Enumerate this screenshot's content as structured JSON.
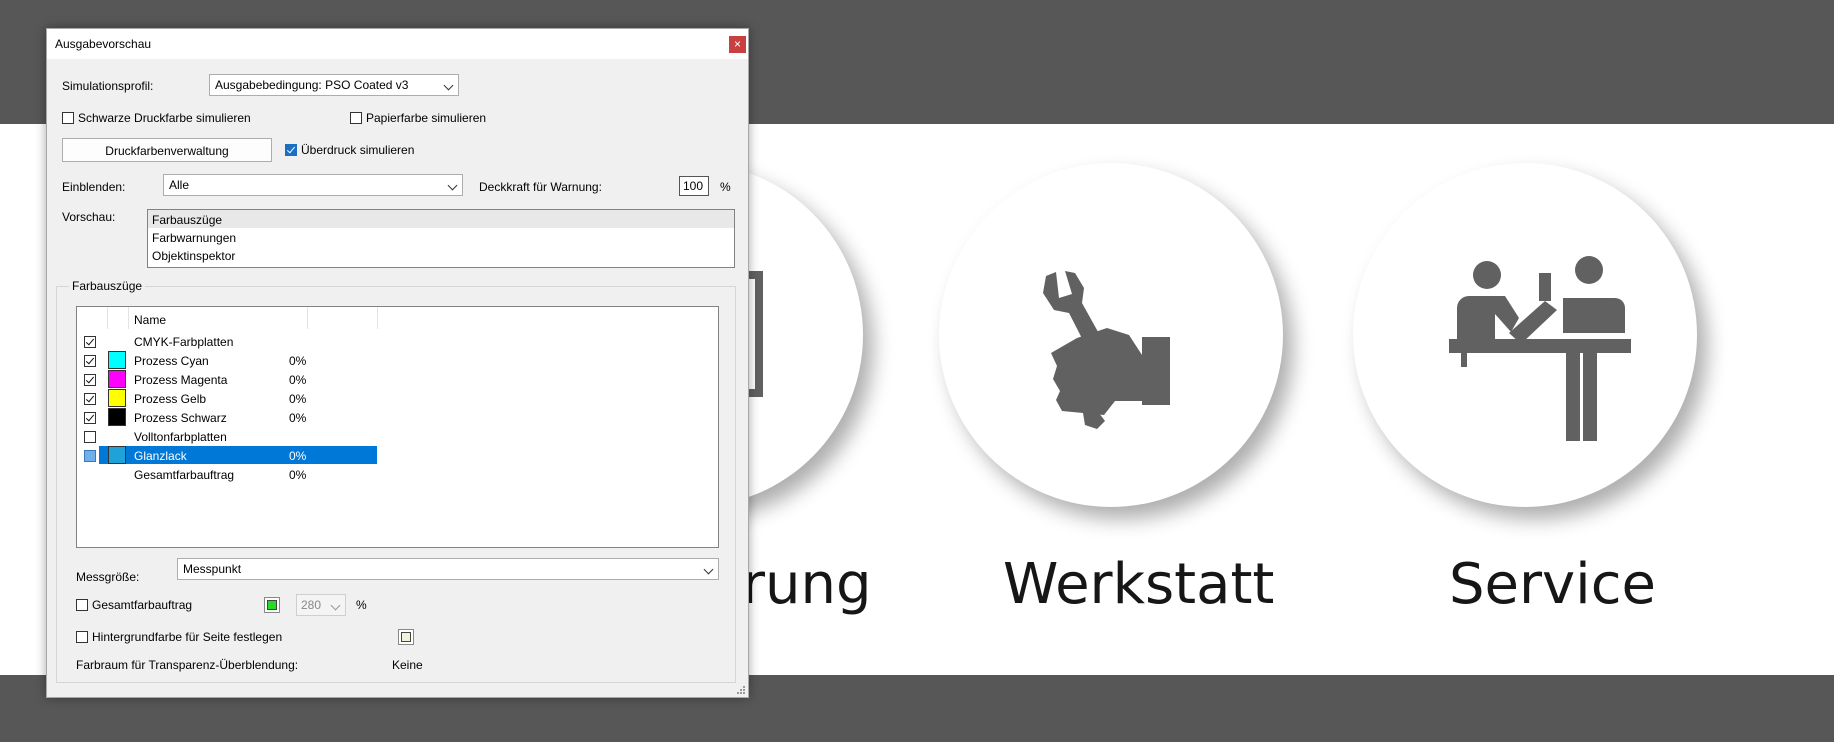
{
  "background": {
    "items": [
      {
        "label": "rung",
        "icon": "clipboard-icon"
      },
      {
        "label": "Werkstatt",
        "icon": "wrench-hand-icon"
      },
      {
        "label": "Service",
        "icon": "service-counter-icon"
      }
    ]
  },
  "dialog": {
    "title": "Ausgabevorschau",
    "close_glyph": "×",
    "simulation_profile_label": "Simulationsprofil:",
    "simulation_profile_value": "Ausgabebedingung: PSO Coated v3",
    "simulate_black_ink": {
      "label": "Schwarze Druckfarbe simulieren",
      "checked": false
    },
    "simulate_paper_color": {
      "label": "Papierfarbe simulieren",
      "checked": false
    },
    "ink_manager_button": "Druckfarbenverwaltung",
    "simulate_overprint": {
      "label": "Überdruck simulieren",
      "checked": true
    },
    "show_label": "Einblenden:",
    "show_value": "Alle",
    "warning_opacity_label": "Deckkraft für Warnung:",
    "warning_opacity_value": "100",
    "warning_opacity_unit": "%",
    "preview_label": "Vorschau:",
    "preview_options": [
      "Farbauszüge",
      "Farbwarnungen",
      "Objektinspektor"
    ],
    "preview_selected": "Farbauszüge",
    "separations_group_title": "Farbauszüge",
    "separations_column_name": "Name",
    "separations": [
      {
        "name": "CMYK-Farbplatten",
        "checked": true,
        "color": null,
        "percent": ""
      },
      {
        "name": "Prozess Cyan",
        "checked": true,
        "color": "#00ffff",
        "percent": "0%"
      },
      {
        "name": "Prozess Magenta",
        "checked": true,
        "color": "#ff00ff",
        "percent": "0%"
      },
      {
        "name": "Prozess Gelb",
        "checked": true,
        "color": "#ffff00",
        "percent": "0%"
      },
      {
        "name": "Prozess Schwarz",
        "checked": true,
        "color": "#000000",
        "percent": "0%"
      },
      {
        "name": "Volltonfarbplatten",
        "checked": false,
        "color": null,
        "percent": ""
      },
      {
        "name": "Glanzlack",
        "checked": false,
        "color": "#1ea2d8",
        "percent": "0%",
        "selected": true
      },
      {
        "name": "Gesamtfarbauftrag",
        "checked": null,
        "color": null,
        "percent": "0%"
      }
    ],
    "sample_size_label": "Messgröße:",
    "sample_size_value": "Messpunkt",
    "total_area_coverage": {
      "label": "Gesamtfarbauftrag",
      "checked": false,
      "swatch_color": "#22dd22",
      "value": "280",
      "unit": "%"
    },
    "page_background": {
      "label": "Hintergrundfarbe für Seite festlegen",
      "checked": false,
      "swatch_color": "#f2f2d8"
    },
    "blending_space_label": "Farbraum für Transparenz-Überblendung:",
    "blending_space_value": "Keine"
  }
}
